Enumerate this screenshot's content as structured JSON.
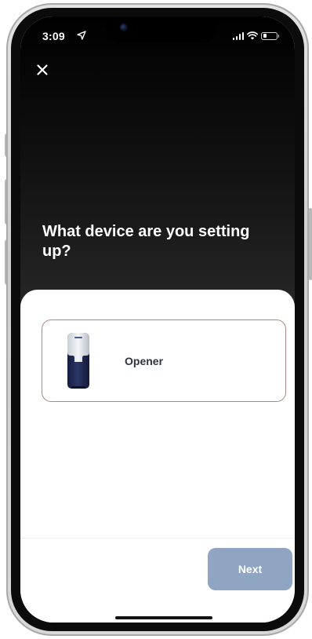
{
  "status_bar": {
    "time": "3:09",
    "location_icon": "location-arrow-icon",
    "signal_icon": "cellular-signal-icon",
    "wifi_icon": "wifi-icon",
    "battery_icon": "battery-icon",
    "battery_level": 0.25
  },
  "header": {
    "close_icon": "close-icon",
    "title": "What device are you setting up?"
  },
  "options": [
    {
      "label": "Opener",
      "image": "opener-device-image"
    }
  ],
  "footer": {
    "next_label": "Next"
  },
  "colors": {
    "hero_background": "#000000",
    "card_border": "#a98985",
    "next_button": "#90a5c2",
    "device_body": "#1f2a52",
    "label_text": "#2c3440"
  }
}
